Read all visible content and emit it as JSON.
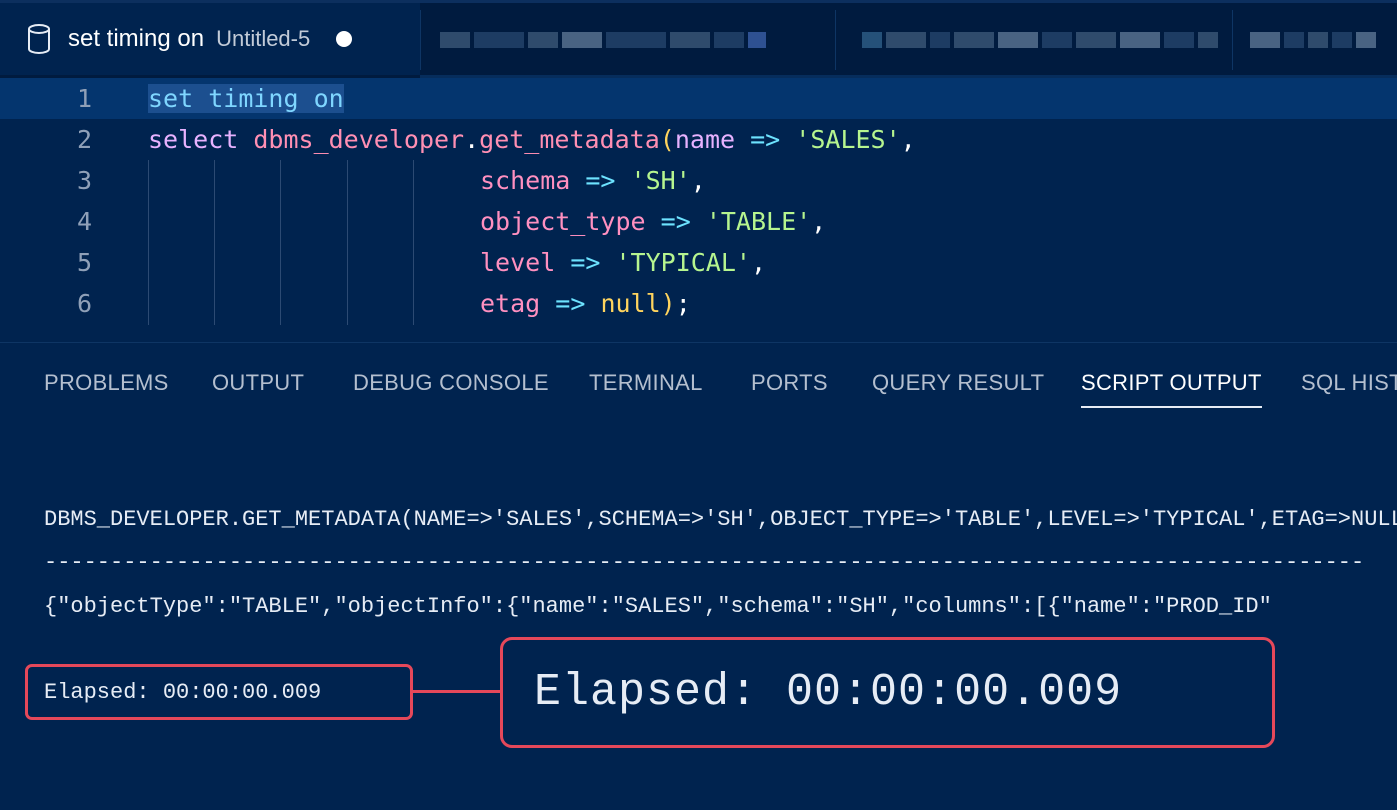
{
  "tabs": {
    "active": {
      "title": "set timing on",
      "subtitle": "Untitled-5",
      "icon": "database-icon",
      "dirty": true
    }
  },
  "editor": {
    "lines": [
      {
        "num": "1",
        "tokens": [
          [
            "kw",
            "set"
          ],
          [
            "pn",
            " "
          ],
          [
            "kw",
            "timing"
          ],
          [
            "pn",
            " "
          ],
          [
            "kw",
            "on"
          ]
        ]
      },
      {
        "num": "2",
        "tokens": [
          [
            "kw2",
            "select"
          ],
          [
            "pn",
            " "
          ],
          [
            "fn",
            "dbms_developer"
          ],
          [
            "pn",
            "."
          ],
          [
            "fn",
            "get_metadata"
          ],
          [
            "par",
            "("
          ],
          [
            "nm",
            "name"
          ],
          [
            "pn",
            " "
          ],
          [
            "arr",
            "=>"
          ],
          [
            "pn",
            " "
          ],
          [
            "str",
            "'SALES'"
          ],
          [
            "pn",
            ","
          ]
        ]
      },
      {
        "num": "3",
        "tokens": [
          [
            "param",
            "schema"
          ],
          [
            "pn",
            " "
          ],
          [
            "arr",
            "=>"
          ],
          [
            "pn",
            " "
          ],
          [
            "str",
            "'SH'"
          ],
          [
            "pn",
            ","
          ]
        ]
      },
      {
        "num": "4",
        "tokens": [
          [
            "param",
            "object_type"
          ],
          [
            "pn",
            " "
          ],
          [
            "arr",
            "=>"
          ],
          [
            "pn",
            " "
          ],
          [
            "str",
            "'TABLE'"
          ],
          [
            "pn",
            ","
          ]
        ]
      },
      {
        "num": "5",
        "tokens": [
          [
            "param",
            "level"
          ],
          [
            "pn",
            " "
          ],
          [
            "arr",
            "=>"
          ],
          [
            "pn",
            " "
          ],
          [
            "str",
            "'TYPICAL'"
          ],
          [
            "pn",
            ","
          ]
        ]
      },
      {
        "num": "6",
        "tokens": [
          [
            "param",
            "etag"
          ],
          [
            "pn",
            " "
          ],
          [
            "arr",
            "=>"
          ],
          [
            "pn",
            " "
          ],
          [
            "nul",
            "null"
          ],
          [
            "par",
            ")"
          ],
          [
            "pn",
            ";"
          ]
        ]
      }
    ]
  },
  "panel": {
    "tabs": [
      "PROBLEMS",
      "OUTPUT",
      "DEBUG CONSOLE",
      "TERMINAL",
      "PORTS",
      "QUERY RESULT",
      "SCRIPT OUTPUT",
      "SQL HISTORY"
    ],
    "active_tab": "SCRIPT OUTPUT",
    "output": {
      "header": "DBMS_DEVELOPER.GET_METADATA(NAME=>'SALES',SCHEMA=>'SH',OBJECT_TYPE=>'TABLE',LEVEL=>'TYPICAL',ETAG=>NULL)",
      "separator": "----------------------------------------------------------------------------------------------------",
      "json": "{\"objectType\":\"TABLE\",\"objectInfo\":{\"name\":\"SALES\",\"schema\":\"SH\",\"columns\":[{\"name\":\"PROD_ID\"",
      "elapsed": "Elapsed: 00:00:00.009"
    },
    "callout": {
      "text": "Elapsed: 00:00:00.009",
      "color": "#e5485a"
    }
  }
}
